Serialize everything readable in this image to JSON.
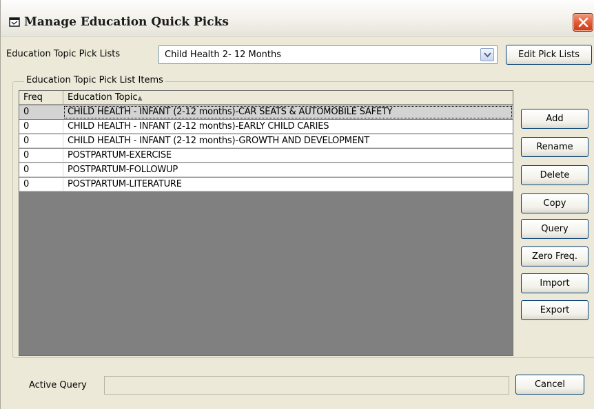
{
  "window": {
    "title": "Manage Education Quick Picks"
  },
  "pick_list": {
    "label": "Education Topic Pick Lists",
    "selected_value": "Child Health 2- 12 Months",
    "edit_button_label": "Edit Pick Lists"
  },
  "group": {
    "title": "Education Topic Pick List Items"
  },
  "table": {
    "columns": [
      "Freq",
      "Education Topic"
    ],
    "sort_column": "Education Topic",
    "sort_direction": "ascending",
    "rows": [
      {
        "freq": "0",
        "topic": "CHILD HEALTH - INFANT (2-12 months)-CAR SEATS & AUTOMOBILE SAFETY",
        "selected": true
      },
      {
        "freq": "0",
        "topic": "CHILD HEALTH - INFANT (2-12 months)-EARLY CHILD CARIES",
        "selected": false
      },
      {
        "freq": "0",
        "topic": "CHILD HEALTH - INFANT (2-12 months)-GROWTH AND DEVELOPMENT",
        "selected": false
      },
      {
        "freq": "0",
        "topic": "POSTPARTUM-EXERCISE",
        "selected": false
      },
      {
        "freq": "0",
        "topic": "POSTPARTUM-FOLLOWUP",
        "selected": false
      },
      {
        "freq": "0",
        "topic": "POSTPARTUM-LITERATURE",
        "selected": false
      }
    ]
  },
  "actions": {
    "add": "Add",
    "rename": "Rename",
    "delete": "Delete",
    "copy": "Copy",
    "query": "Query",
    "zero_freq": "Zero Freq.",
    "import": "Import",
    "export": "Export"
  },
  "footer": {
    "active_query_label": "Active Query",
    "active_query_value": "",
    "cancel_label": "Cancel"
  },
  "colors": {
    "window_bg": "#ece9d8",
    "grid_empty_bg": "#808080",
    "selected_row_bg": "#d3d3d3",
    "close_button": "#e3562f",
    "button_border": "#003c74"
  },
  "icons": {
    "title_icon": "window-icon",
    "close": "close-icon",
    "dropdown": "chevron-down-icon",
    "sort": "sort-ascending-icon"
  }
}
